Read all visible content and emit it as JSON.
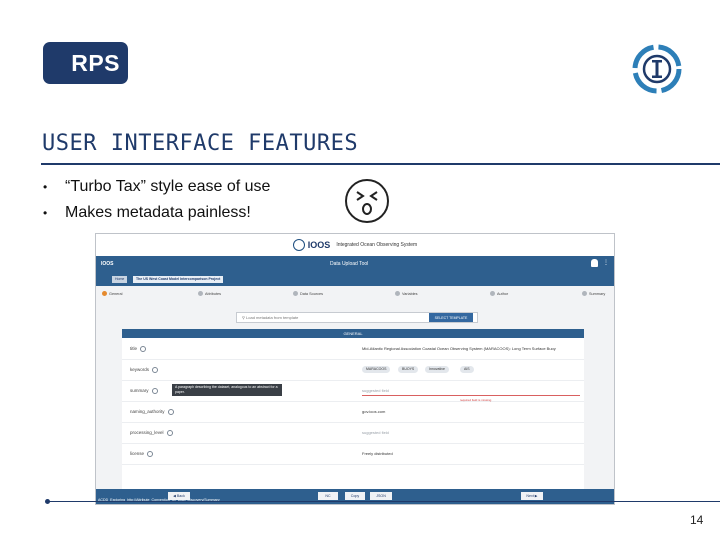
{
  "logo": {
    "rps_text": "RPS"
  },
  "title": "USER INTERFACE FEATURES",
  "bullets": [
    {
      "marker": "•",
      "text": "“Turbo Tax” style ease of use"
    },
    {
      "marker": "•",
      "text": "Makes metadata painless!"
    }
  ],
  "screenshot": {
    "topbar": {
      "word": "IOOS",
      "subtitle": "Integrated Ocean Observing System"
    },
    "header": {
      "brand": "IOOS",
      "tool_title": "Data Upload Tool",
      "menu_icon": "⋮"
    },
    "breadcrumb": {
      "home": "Home",
      "project": "The US West Coast Model Intercomparison Project"
    },
    "steps": [
      "General",
      "Attributes",
      "Data Sources",
      "Variables",
      "Author",
      "Summary"
    ],
    "search_placeholder": "Load metadata from template",
    "select_button": "SELECT TEMPLATE",
    "section_title": "GENERAL",
    "rows": {
      "title": {
        "label": "title",
        "value": "Mid-Atlantic Regional Association Coastal Ocean Observing System (MARACOOS): Long Term Surface Buoy"
      },
      "keywords": {
        "label": "keywords",
        "chips": [
          "MARACOOS",
          "BUOYS",
          "Innovative",
          "AIS"
        ]
      },
      "summary": {
        "label": "summary",
        "tooltip": "A paragraph describing the dataset, analogous to an abstract for a paper.",
        "placeholder": "suggested field",
        "error": "required field is missing"
      },
      "naming": {
        "label": "naming_authority",
        "value": "gov.ioos.com"
      },
      "processing": {
        "label": "processing_level",
        "placeholder": "suggested field"
      },
      "license": {
        "label": "license",
        "value": "Freely distributed"
      }
    },
    "footer": {
      "path": "ACDD_Exploring_http://Attribute_Convention_for_Data_Discovery/Summary",
      "back": "◀ Back",
      "btn_nc": "NC",
      "btn_copy": "Copy",
      "btn_json": "JSON",
      "next": "Next ▶"
    }
  },
  "page_number": "14"
}
